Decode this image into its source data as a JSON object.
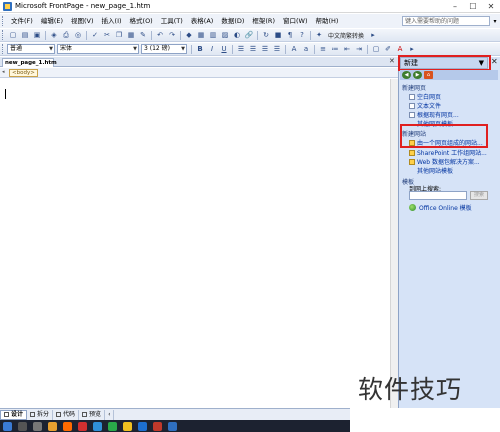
{
  "window": {
    "title": "Microsoft FrontPage - new_page_1.htm",
    "minimize": "–",
    "maximize": "☐",
    "close": "✕"
  },
  "menu": {
    "items": [
      "文件(F)",
      "编辑(E)",
      "视图(V)",
      "插入(I)",
      "格式(O)",
      "工具(T)",
      "表格(A)",
      "数据(D)",
      "框架(R)",
      "窗口(W)",
      "帮助(H)"
    ],
    "help_placeholder": "键入需要帮助的问题",
    "help_dropdown": "▾"
  },
  "toolbar1": {
    "language_button": "中文简繁转换"
  },
  "toolbar2": {
    "style_value": "普通",
    "font_value": "宋体",
    "size_value": "3 (12 磅)",
    "bold": "B",
    "italic": "I",
    "underline": "U"
  },
  "document": {
    "tab_label": "new_page_1.htm",
    "close": "✕",
    "tag": "<body>"
  },
  "task_pane": {
    "title": "新建",
    "close": "✕",
    "sections": {
      "new_page": {
        "title": "新建网页",
        "links": [
          "空白网页",
          "文本文件",
          "根据现有网页...",
          "其他网页模板"
        ]
      },
      "new_site": {
        "title": "新建网站",
        "links": [
          "由一个网页组成的网站...",
          "SharePoint 工作组网站...",
          "Web 数据包解决方案...",
          "其他网站模板"
        ]
      },
      "templates": {
        "title": "模板",
        "search_label": "到网上搜索:",
        "go_button": "搜索",
        "office_link": "Office Online 模板"
      }
    }
  },
  "view_tabs": [
    "设计",
    "拆分",
    "代码",
    "预览"
  ],
  "watermark": "软件技巧",
  "colors": {
    "highlight_border": "#e02020",
    "pane_background": "#d6e3f7",
    "link_color": "#0033a0"
  }
}
